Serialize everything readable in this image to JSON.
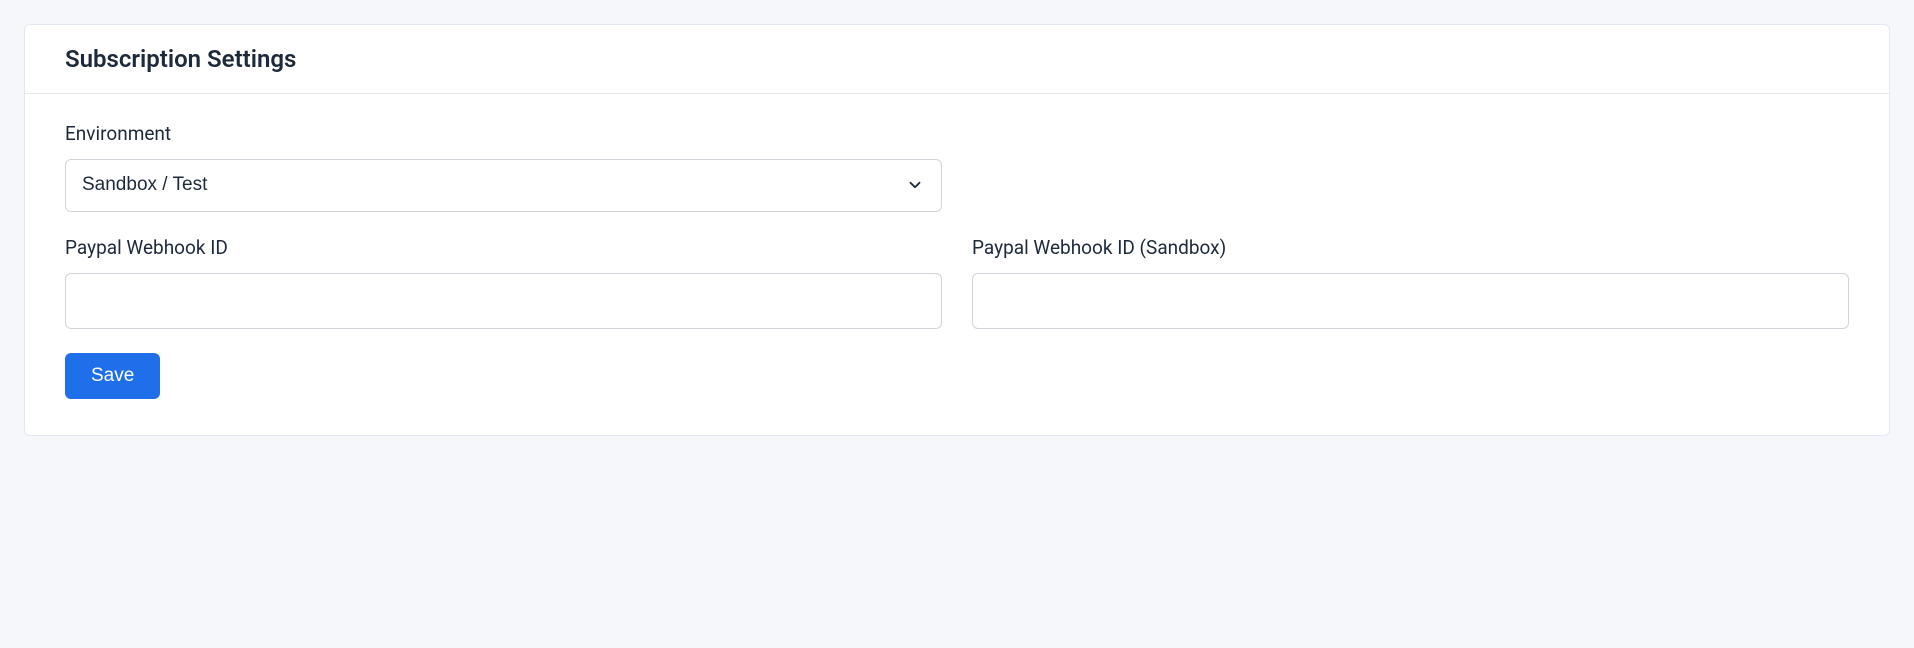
{
  "card": {
    "title": "Subscription Settings"
  },
  "form": {
    "environment": {
      "label": "Environment",
      "selected": "Sandbox / Test"
    },
    "webhook_id": {
      "label": "Paypal Webhook ID",
      "value": ""
    },
    "webhook_id_sandbox": {
      "label": "Paypal Webhook ID (Sandbox)",
      "value": ""
    },
    "save_label": "Save"
  }
}
